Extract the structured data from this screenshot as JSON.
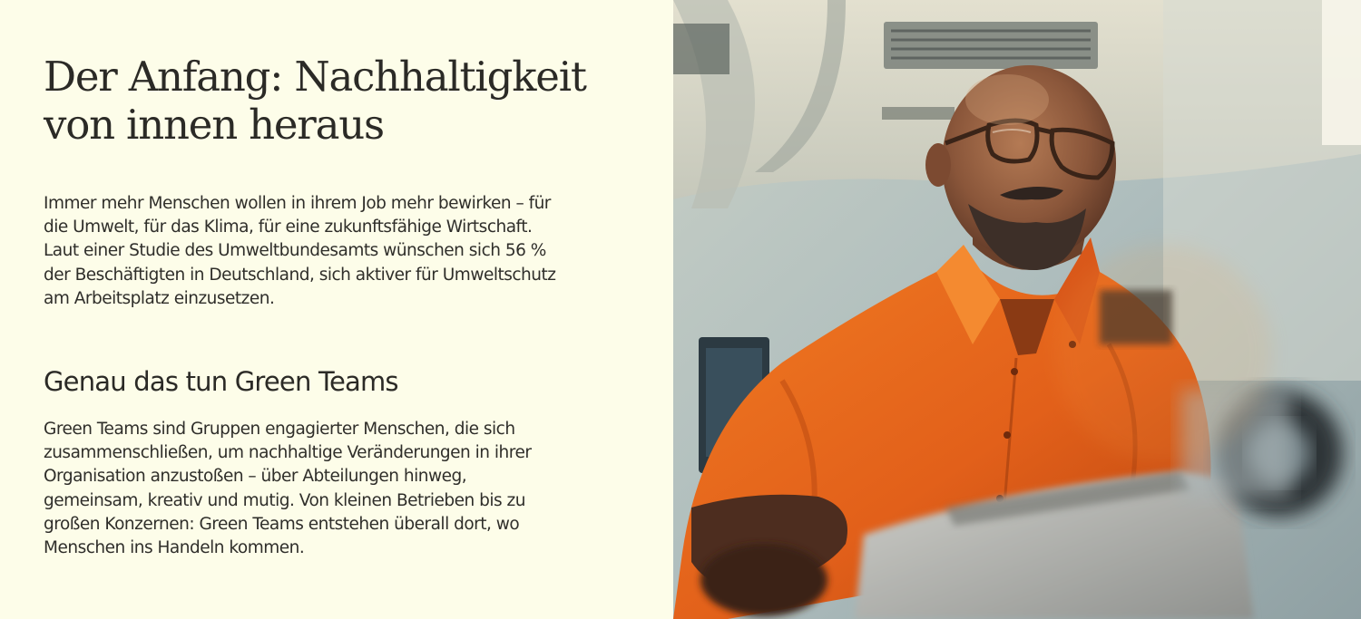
{
  "article": {
    "headline": "Der Anfang: Nachhaltigkeit von innen heraus",
    "intro": "Immer mehr Menschen wollen in ihrem Job mehr bewirken – für die Umwelt, für das Klima, für eine zukunftsfähige Wirtschaft. Laut einer Studie des Umweltbundesamts wünschen sich 56 % der Beschäftigten in Deutschland, sich aktiver für Umweltschutz am Arbeitsplatz einzusetzen.",
    "subheading": "Genau das tun Green Teams",
    "teams_text": "Green Teams sind Gruppen engagierter Menschen, die sich zusammenschließen, um nachhaltige Veränderungen in ihrer Organisation anzustoßen – über Abteilungen hinweg, gemeinsam, kreativ und mutig. Von kleinen Betrieben bis zu großen Konzernen: Green Teams entstehen überall dort, wo Menschen ins Handeln kommen."
  },
  "colors": {
    "background": "#fdfde9",
    "text": "#2b2a26",
    "shirt": "#e8681a"
  }
}
